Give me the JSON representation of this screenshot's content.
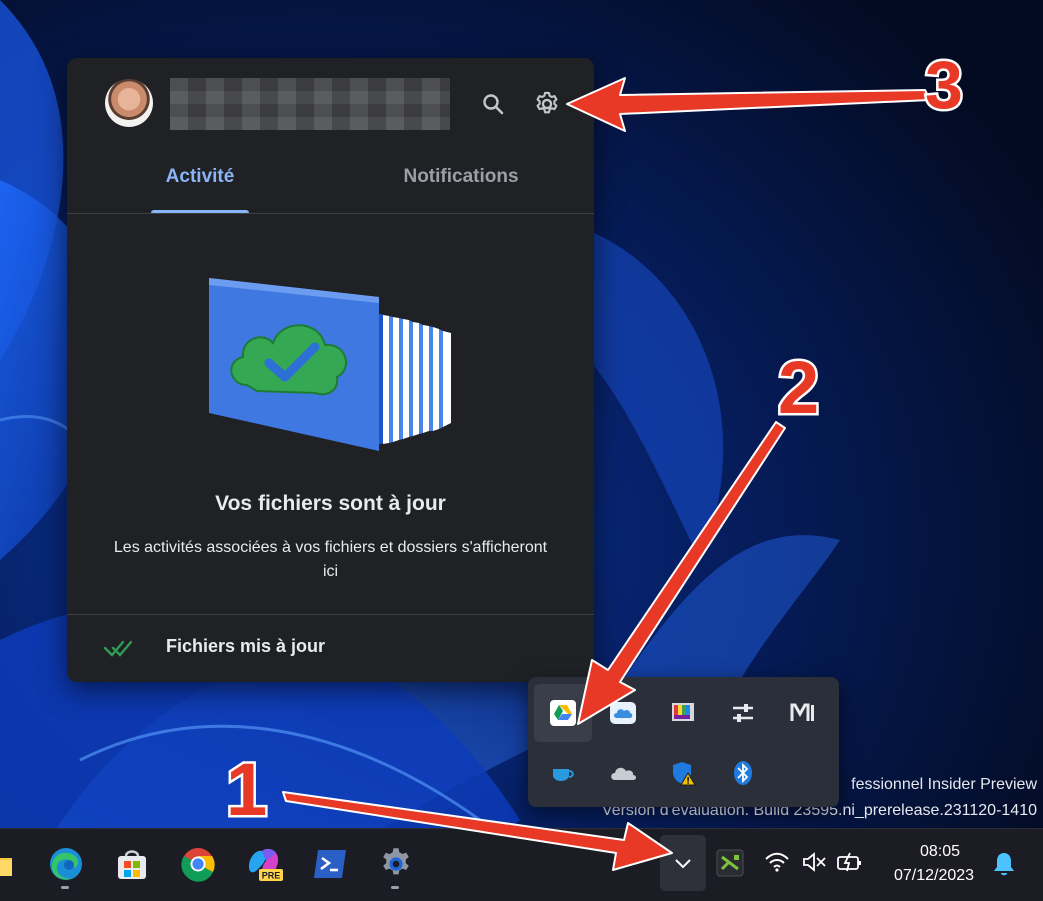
{
  "desktop": {
    "watermark_line1": "fessionnel Insider Preview",
    "watermark_line2": "Version d'évaluation. Build 23595.ni_prerelease.231120-1410"
  },
  "drive_panel": {
    "account_name": "",
    "search_icon": "search-icon",
    "settings_icon": "gear-icon",
    "tabs": [
      {
        "label": "Activité",
        "active": true
      },
      {
        "label": "Notifications",
        "active": false
      }
    ],
    "status_title": "Vos fichiers sont à jour",
    "status_description": "Les activités associées à vos fichiers et dossiers s'afficheront ici",
    "footer_label": "Fichiers mis à jour",
    "accent_color": "#8ab4f8"
  },
  "tray_overflow": {
    "items": [
      "google-drive-icon",
      "icloud-icon",
      "display-color-icon",
      "sliders-icon",
      "mi-icon",
      "coffee-cup-icon",
      "onedrive-icon",
      "windows-security-warning-icon",
      "bluetooth-icon"
    ]
  },
  "taskbar": {
    "apps": [
      "file-explorer-icon",
      "edge-icon",
      "microsoft-store-icon",
      "chrome-icon",
      "copilot-pre-icon",
      "terminal-icon",
      "settings-icon"
    ],
    "copilot_badge": "PRE",
    "clock_time": "08:05",
    "clock_date": "07/12/2023"
  },
  "annotations": {
    "labels": [
      "1",
      "2",
      "3"
    ],
    "color": "#e83826"
  }
}
